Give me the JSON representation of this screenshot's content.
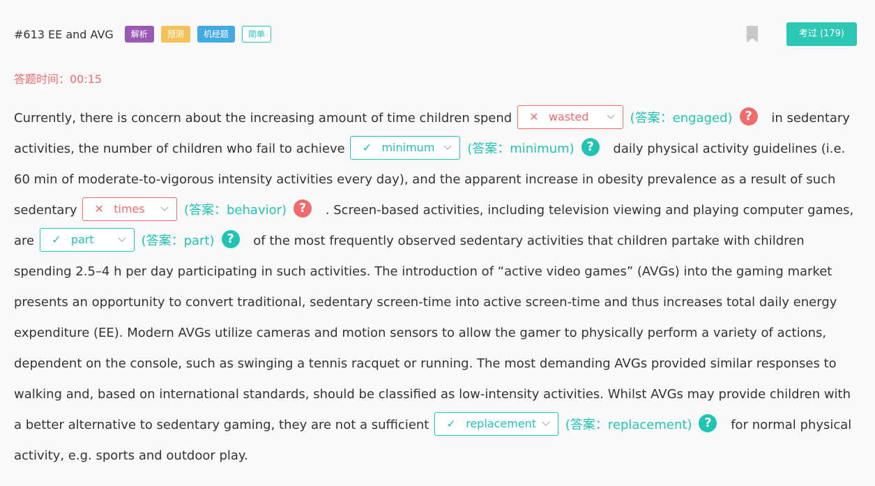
{
  "header": {
    "title": "#613 EE and AVG",
    "tags": [
      "解析",
      "预测",
      "机经题",
      "简单"
    ],
    "exam_button": "考过 (179)"
  },
  "timer": "答题时间：00:15",
  "colors": {
    "teal": "#21c3b3",
    "red": "#f06b6b",
    "button": "#2cc8b4"
  },
  "passage": {
    "t0": "Currently, there is concern about the increasing amount of time children spend",
    "t1": "in sedentary activities, the number of children who fail to achieve",
    "t2": "daily physical activity guidelines (i.e. 60 min of moderate-to-vigorous intensity activities every day), and the apparent increase in obesity prevalence as a result of such sedentary",
    "t3": ". Screen-based activities, including television viewing and playing computer games, are",
    "t4": "of the most frequently observed sedentary activities that children partake with children spending 2.5–4 h per day participating in such activities. The introduction of “active video games” (AVGs) into the gaming market presents an opportunity to convert traditional, sedentary screen-time into active screen-time and thus increases total daily energy expenditure (EE). Modern AVGs utilize cameras and motion sensors to allow the gamer to physically perform a variety of actions, dependent on the console, such as swinging a tennis racquet or running. The most demanding AVGs provided similar responses to walking and, based on international standards, should be classified as low-intensity activities. Whilst AVGs may provide children with a better alternative to sedentary gaming, they are not a sufficient",
    "t5": "for normal physical activity, e.g. sports and outdoor play."
  },
  "blanks": [
    {
      "value": "wasted",
      "answer": "(答案：engaged)",
      "status": "wrong",
      "mark": "✕"
    },
    {
      "value": "minimum",
      "answer": "(答案：minimum)",
      "status": "right",
      "mark": "✓"
    },
    {
      "value": "times",
      "answer": "(答案：behavior)",
      "status": "wrong",
      "mark": "✕"
    },
    {
      "value": "part",
      "answer": "(答案：part)",
      "status": "right",
      "mark": "✓"
    },
    {
      "value": "replacement",
      "answer": "(答案：replacement)",
      "status": "right",
      "mark": "✓"
    }
  ],
  "help_glyph": "?"
}
